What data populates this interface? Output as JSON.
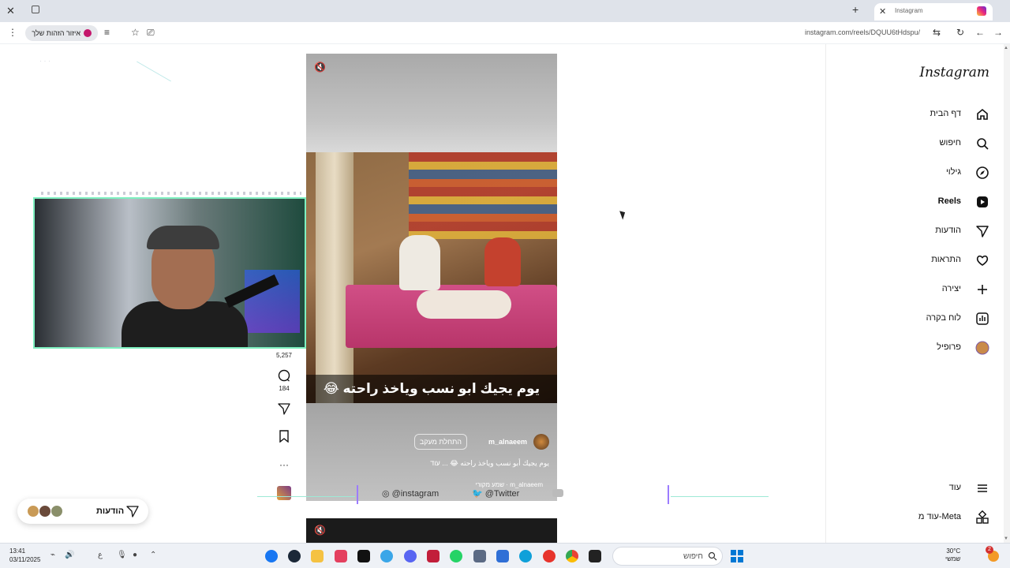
{
  "browser": {
    "tab_title": "Instagram",
    "url": "instagram.com/reels/DQUU6tHdspu/",
    "identity_label": "איזור הזהות שלך"
  },
  "sidebar": {
    "logo": "Instagram",
    "items": [
      {
        "label": "דף הבית",
        "icon": "home-icon"
      },
      {
        "label": "חיפוש",
        "icon": "search-icon"
      },
      {
        "label": "גילוי",
        "icon": "compass-icon"
      },
      {
        "label": "Reels",
        "icon": "reels-icon"
      },
      {
        "label": "הודעות",
        "icon": "messages-icon"
      },
      {
        "label": "התראות",
        "icon": "heart-icon"
      },
      {
        "label": "יצירה",
        "icon": "plus-icon"
      },
      {
        "label": "לוח בקרה",
        "icon": "dashboard-icon"
      },
      {
        "label": "פרופיל",
        "icon": "profile-avatar-icon"
      }
    ],
    "more": "עוד",
    "meta_more": "עוד מ-Meta"
  },
  "reel": {
    "caption_overlay": "يوم يجيك ابو نسب وياخذ راحته 😂",
    "author": "m_alnaeem",
    "follow_label": "התחלת מעקב",
    "description": "يوم يجيك أبو نسب وياخذ راحته 😂 ... עוד",
    "audio": "m_alnaeem · שמע מקורי"
  },
  "actions": {
    "likes": "5,257",
    "comments": "184"
  },
  "messages_chip": {
    "label": "הודעות"
  },
  "overlay_social": {
    "instagram": "@instagram",
    "twitter": "@Twitter"
  },
  "taskbar": {
    "time": "13:41",
    "date": "03/11/2025",
    "search": "חיפוש",
    "weather_temp": "30°C",
    "weather_desc": "שמשי",
    "notification_count": "2"
  },
  "colors": {
    "accent": "#c4176c",
    "webcam_border": "#7ef0c0",
    "overlay_bracket": "#9c7cff"
  }
}
